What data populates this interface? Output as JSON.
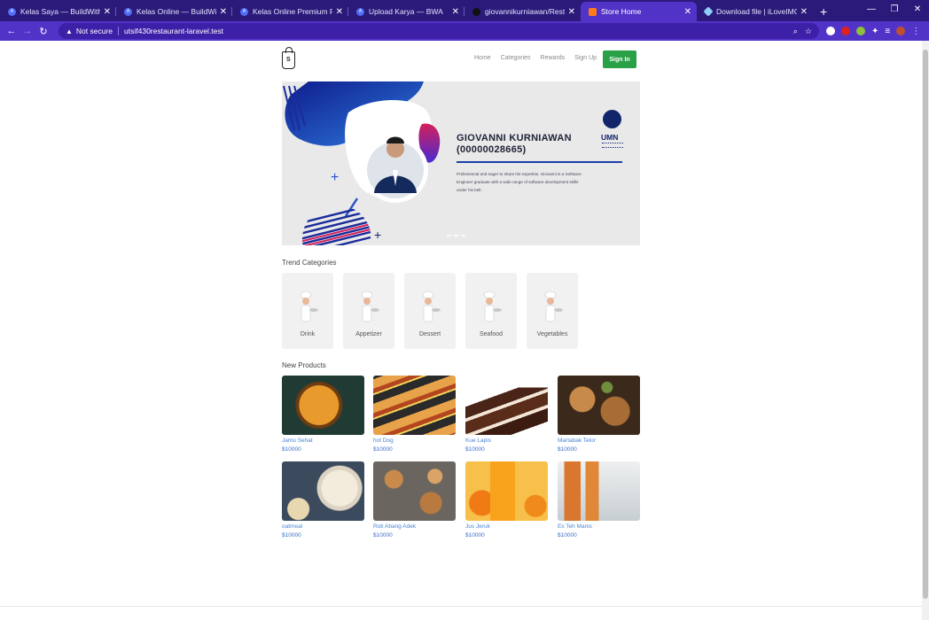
{
  "browser": {
    "tabs": [
      {
        "title": "Kelas Saya — BuildWith Angga",
        "icon": "bwa"
      },
      {
        "title": "Kelas Online — BuildWith Angga",
        "icon": "bwa"
      },
      {
        "title": "Kelas Online Premium Full-Stack",
        "icon": "bwa"
      },
      {
        "title": "Upload Karya — BWA",
        "icon": "bwa"
      },
      {
        "title": "giovannikurniawan/Restoran: W",
        "icon": "github"
      },
      {
        "title": "Store Home",
        "icon": "store",
        "active": true
      },
      {
        "title": "Download file | iLoveIMG",
        "icon": "iloveimg"
      }
    ],
    "security_label": "Not secure",
    "url": "utsif430restaurant-laravel.test"
  },
  "site": {
    "logo_letter": "S",
    "nav": [
      "Home",
      "Categories",
      "Rewards",
      "Sign Up"
    ],
    "signin_label": "Sign In",
    "hero": {
      "name": "GIOVANNI KURNIAWAN",
      "id": "(00000028665)",
      "description": "Professional and eager to share his expertise, Giovanni is a Software Engineer graduate with a wide range of software development skills under his belt.",
      "org_logo": "UMN"
    },
    "trend_title": "Trend Categories",
    "categories": [
      "Drink",
      "Appetizer",
      "Dessert",
      "Seafood",
      "Vegetables"
    ],
    "new_products_title": "New Products",
    "products": [
      {
        "name": "Jamu Sehat",
        "price": "$10000"
      },
      {
        "name": "hot Dog",
        "price": "$10000"
      },
      {
        "name": "Kue Lapis",
        "price": "$10000"
      },
      {
        "name": "Martabak Telor",
        "price": "$10000"
      },
      {
        "name": "oatmeal",
        "price": "$10000"
      },
      {
        "name": "Roti Abang Adek",
        "price": "$10000"
      },
      {
        "name": "Jus Jeruk",
        "price": "$10000"
      },
      {
        "name": "Es Teh Manis",
        "price": "$10000"
      }
    ]
  },
  "colors": {
    "tabstrip": "#2b1a7a",
    "toolbar": "#5233c8",
    "brand_green": "#2aa147",
    "link_blue": "#4a84d6",
    "hero_navy": "#12256b"
  }
}
